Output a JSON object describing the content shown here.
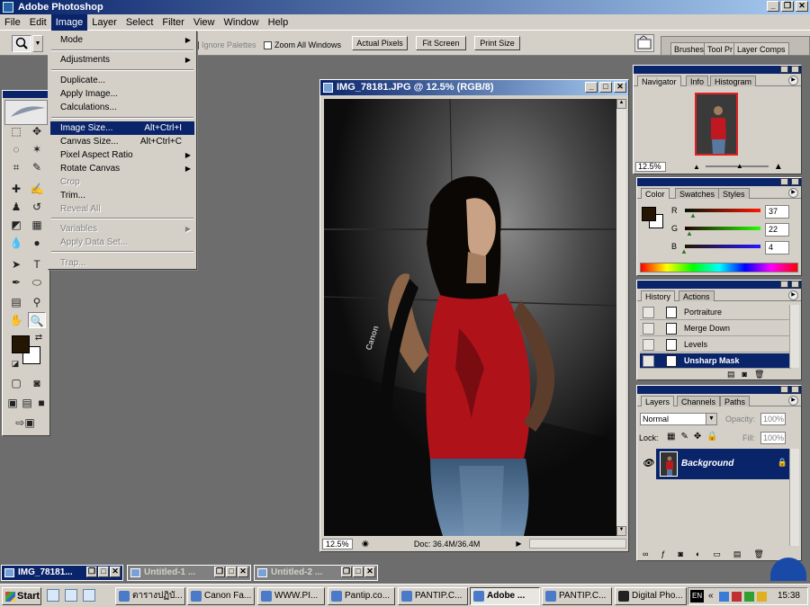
{
  "app": {
    "title": "Adobe Photoshop"
  },
  "menubar": [
    "File",
    "Edit",
    "Image",
    "Layer",
    "Select",
    "Filter",
    "View",
    "Window",
    "Help"
  ],
  "options": {
    "ignore_palettes": "Ignore Palettes",
    "zoom_all_windows": "Zoom All Windows",
    "actual_pixels": "Actual Pixels",
    "fit_screen": "Fit Screen",
    "print_size": "Print Size"
  },
  "palette_well": {
    "brushes": "Brushes",
    "tool_presets": "Tool Pr",
    "layer_comps": "Layer Comps"
  },
  "image_menu": {
    "mode": "Mode",
    "adjustments": "Adjustments",
    "duplicate": "Duplicate...",
    "apply_image": "Apply Image...",
    "calculations": "Calculations...",
    "image_size": "Image Size...",
    "image_size_sc": "Alt+Ctrl+I",
    "canvas_size": "Canvas Size...",
    "canvas_size_sc": "Alt+Ctrl+C",
    "pixel_aspect": "Pixel Aspect Ratio",
    "rotate_canvas": "Rotate Canvas",
    "crop": "Crop",
    "trim": "Trim...",
    "reveal_all": "Reveal All",
    "variables": "Variables",
    "apply_data_set": "Apply Data Set...",
    "trap": "Trap..."
  },
  "document": {
    "title": "IMG_78181.JPG @ 12.5% (RGB/8)",
    "zoom": "12.5%",
    "doc_info": "Doc: 36.4M/36.4M",
    "camera_strap_text": "Canon"
  },
  "navigator": {
    "tabs": [
      "Navigator",
      "Info",
      "Histogram"
    ],
    "zoom": "12.5%"
  },
  "color": {
    "tabs": [
      "Color",
      "Swatches",
      "Styles"
    ],
    "r_label": "R",
    "g_label": "G",
    "b_label": "B",
    "r": "37",
    "g": "22",
    "b": "4",
    "foreground": "#251604"
  },
  "history": {
    "tabs": [
      "History",
      "Actions"
    ],
    "items": [
      "Portraiture",
      "Merge Down",
      "Levels",
      "Unsharp Mask"
    ]
  },
  "layers": {
    "tabs": [
      "Layers",
      "Channels",
      "Paths"
    ],
    "blend_mode": "Normal",
    "opacity_label": "Opacity:",
    "opacity": "100%",
    "lock_label": "Lock:",
    "fill_label": "Fill:",
    "fill": "100%",
    "layer_name": "Background"
  },
  "minimized_windows": [
    "IMG_78181...",
    "Untitled-1 ...",
    "Untitled-2 ..."
  ],
  "taskbar": {
    "start": "Start",
    "tasks": [
      "ตารางปฏิบั...",
      "Canon Fa...",
      "WWW.PI...",
      "Pantip.co...",
      "PANTIP.C...",
      "Adobe ...",
      "PANTIP.C...",
      "Digital Pho..."
    ],
    "lang": "EN",
    "clock": "15:38"
  },
  "colors": {
    "titlebar": "#0a246a",
    "chrome": "#d4d0c8",
    "workspace": "#6d6d6d",
    "selection": "#0a246a"
  }
}
